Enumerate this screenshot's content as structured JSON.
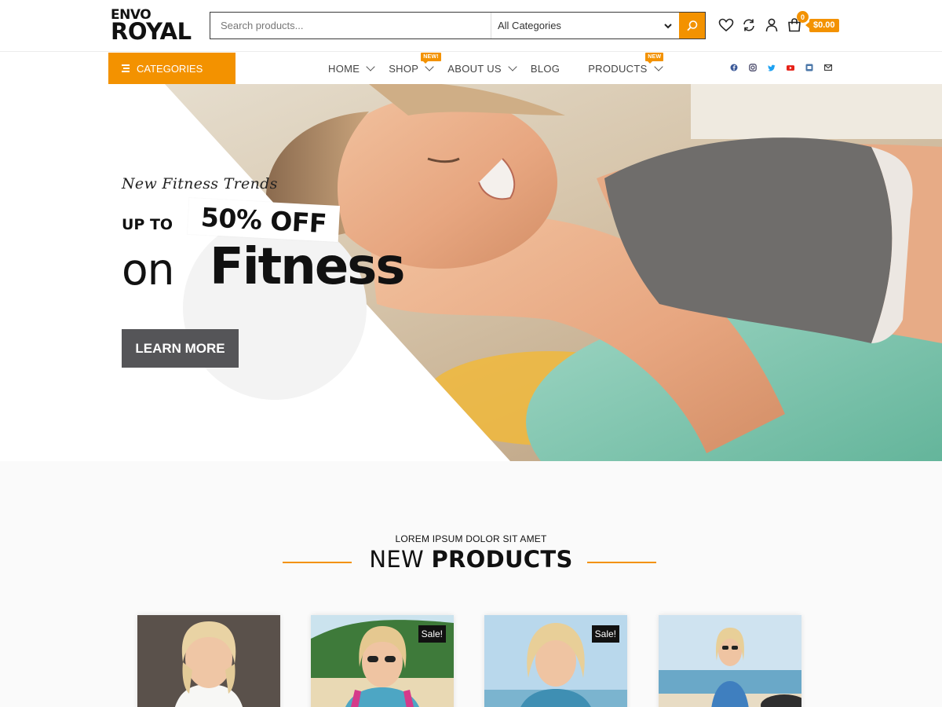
{
  "header": {
    "logo_top": "ENVO",
    "logo_bottom": "ROYAL",
    "search_placeholder": "Search products...",
    "category_select": "All Categories",
    "cart_count": "0",
    "cart_total": "$0.00"
  },
  "icons": {
    "search": "search-icon",
    "wishlist": "heart-icon",
    "compare": "refresh-icon",
    "account": "user-icon",
    "cart": "cart-icon"
  },
  "nav": {
    "categories_label": "CATEGORIES",
    "items": [
      {
        "label": "HOME",
        "has_dropdown": true
      },
      {
        "label": "SHOP",
        "has_dropdown": true,
        "badge": "NEW!"
      },
      {
        "label": "ABOUT US",
        "has_dropdown": true
      },
      {
        "label": "BLOG",
        "has_dropdown": false
      },
      {
        "label": "PRODUCTS",
        "has_dropdown": true,
        "badge": "NEW"
      }
    ],
    "social": [
      "facebook-icon",
      "instagram-icon",
      "twitter-icon",
      "youtube-icon",
      "vk-icon",
      "email-icon"
    ]
  },
  "hero": {
    "kicker": "New Fitness Trends",
    "up_to": "UP TO",
    "discount": "50% OFF",
    "on": "on",
    "headline": "Fitness",
    "cta": "LEARN MORE"
  },
  "products": {
    "subtitle": "LOREM IPSUM DOLOR SIT AMET",
    "title_light": "NEW",
    "title_bold": "PRODUCTS",
    "items": [
      {
        "sale": ""
      },
      {
        "sale": "Sale!"
      },
      {
        "sale": "Sale!"
      },
      {
        "sale": ""
      }
    ]
  },
  "colors": {
    "accent": "#f39200",
    "button_dark": "#555558",
    "text": "#111111"
  }
}
